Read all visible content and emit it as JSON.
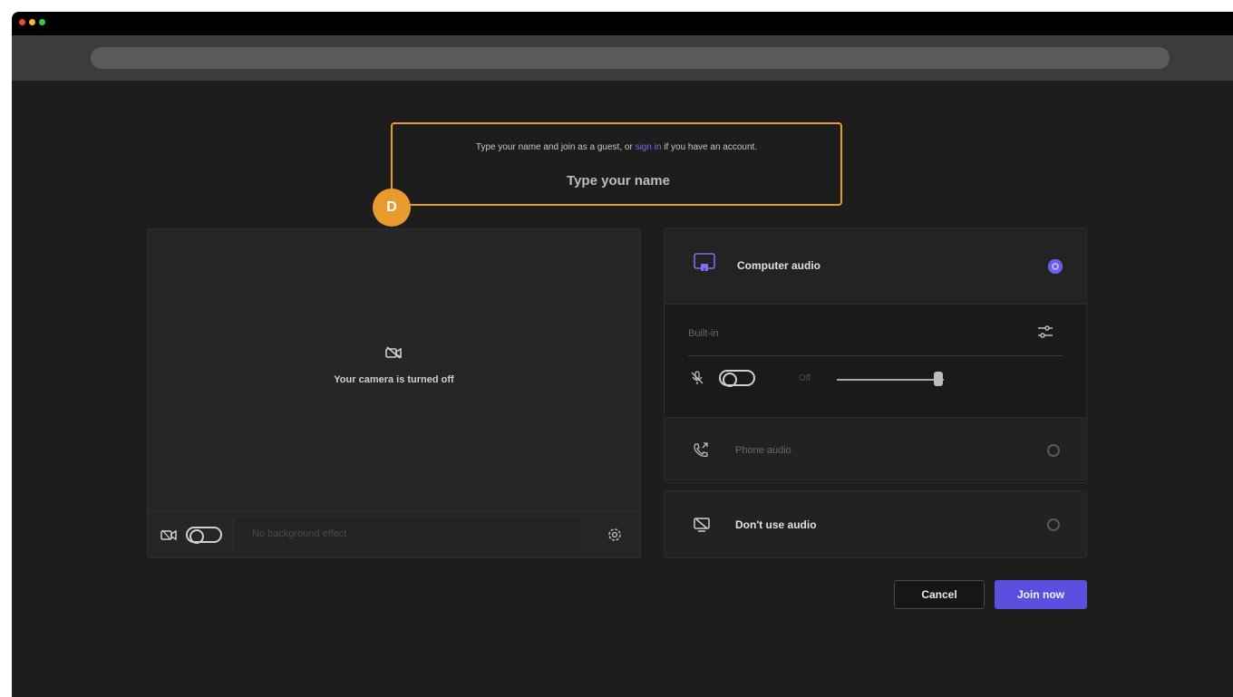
{
  "window": {
    "controls": [
      "close",
      "minimize",
      "maximize"
    ]
  },
  "join": {
    "prompt_before": "Type your name and join as a guest, or ",
    "prompt_link": "sign in",
    "prompt_after": " if you have an account.",
    "name_placeholder": "Type your name",
    "name_value": "",
    "marker_label": "D"
  },
  "preview": {
    "camera_off_text": "Your camera is turned off",
    "background_placeholder": "No background effect",
    "camera_on": false
  },
  "audio": {
    "computer_audio_label": "Computer audio",
    "computer_audio_selected": true,
    "device_label": "Built-in",
    "mic_state_label": "Off",
    "mic_on": false,
    "volume_level": 0.95,
    "phone_audio_label": "Phone audio",
    "no_audio_label": "Don't use audio"
  },
  "actions": {
    "cancel_label": "Cancel",
    "join_label": "Join now"
  },
  "colors": {
    "accent": "#5b4fe0",
    "highlight": "#e99a2c",
    "background": "#1d1d1d"
  },
  "icons": [
    "camera-off-icon",
    "video-icon",
    "gear-icon",
    "computer-audio-icon",
    "adjust-icon",
    "mic-off-icon",
    "phone-icon",
    "no-audio-icon"
  ]
}
